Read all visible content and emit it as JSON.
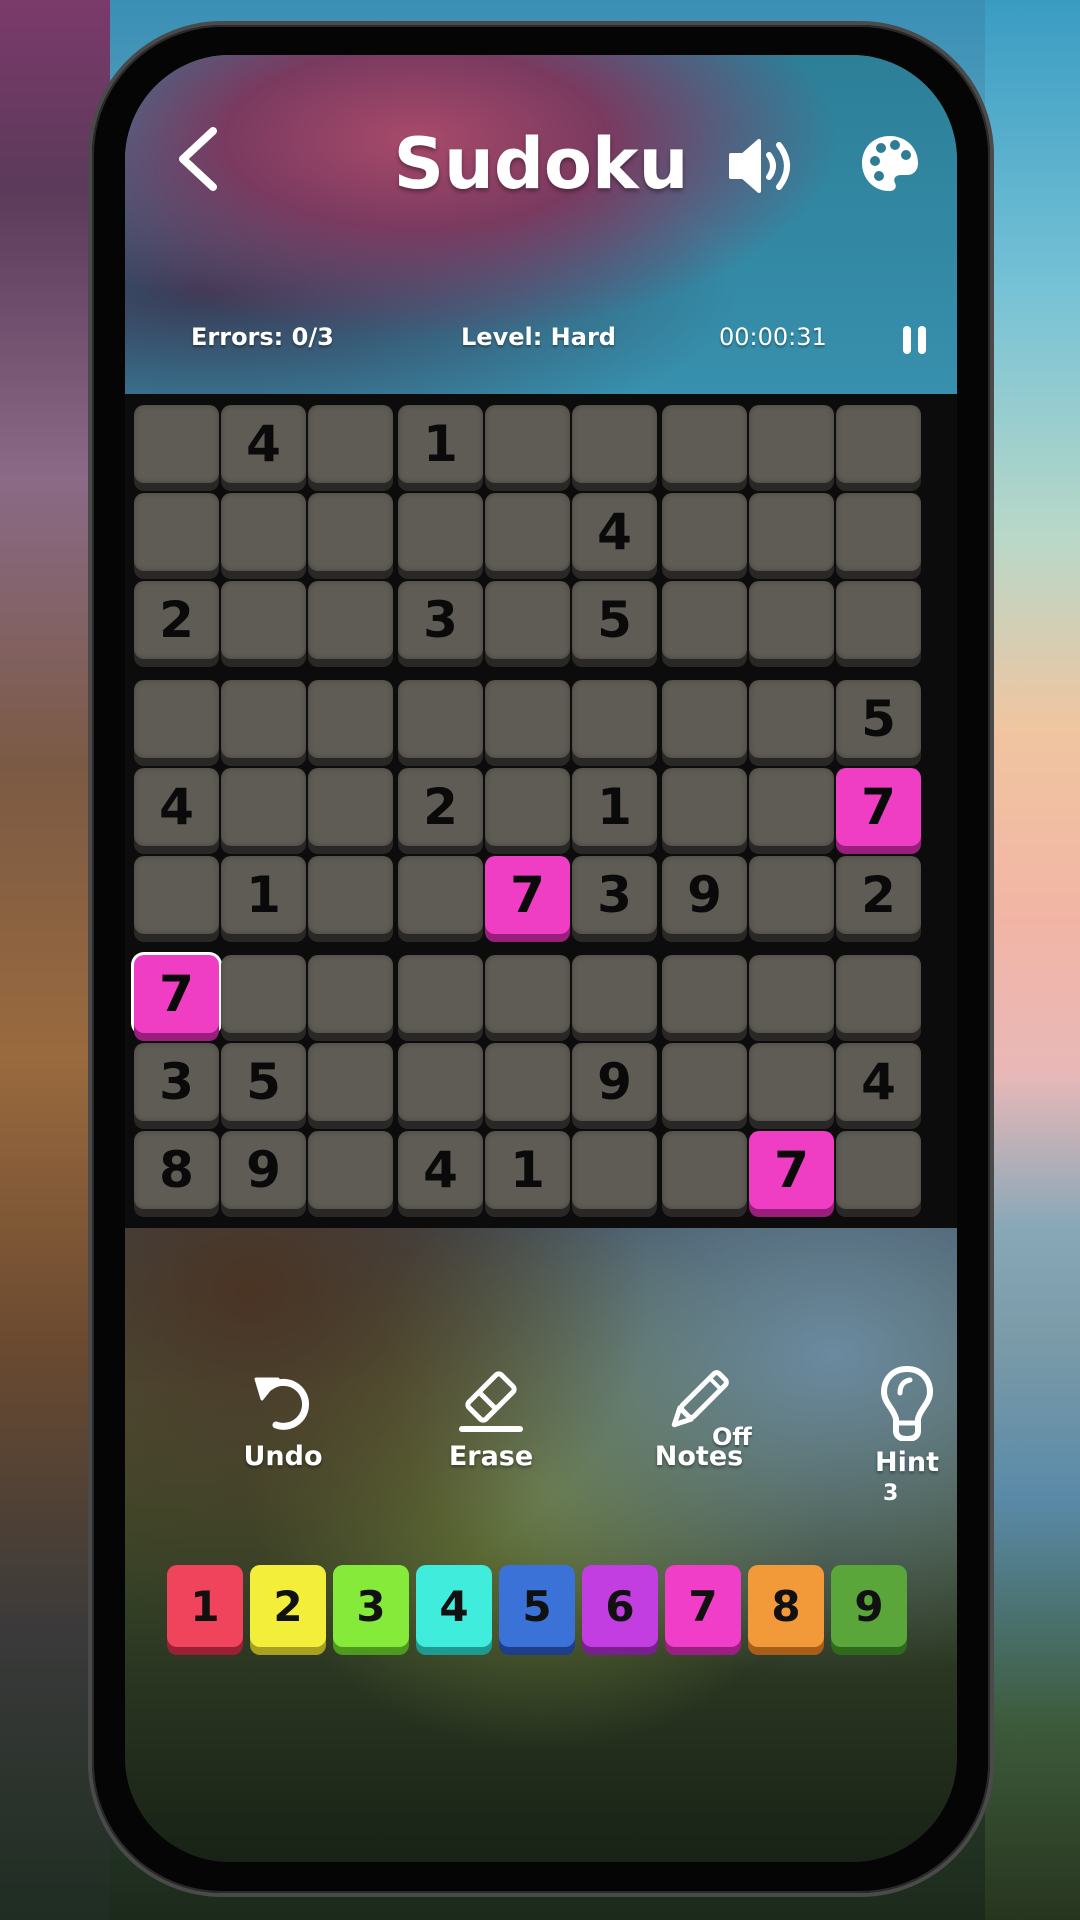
{
  "header": {
    "title": "Sudoku",
    "back_icon": "chevron-left-icon",
    "sound_icon": "speaker-volume-icon",
    "theme_icon": "palette-icon"
  },
  "status": {
    "errors": "Errors: 0/3",
    "level": "Level: Hard",
    "timer": "00:00:31",
    "pause_icon": "pause-icon"
  },
  "board": {
    "highlight_color": "#ef3ec4",
    "cell_color": "#5f5c55",
    "selected": {
      "row": 6,
      "col": 0
    },
    "highlighted_value": "7",
    "rows": [
      [
        "",
        "4",
        "",
        "1",
        "",
        "",
        "",
        "",
        ""
      ],
      [
        "",
        "",
        "",
        "",
        "",
        "4",
        "",
        "",
        ""
      ],
      [
        "2",
        "",
        "",
        "3",
        "",
        "5",
        "",
        "",
        ""
      ],
      [
        "",
        "",
        "",
        "",
        "",
        "",
        "",
        "",
        "5"
      ],
      [
        "4",
        "",
        "",
        "2",
        "",
        "1",
        "",
        "",
        "7"
      ],
      [
        "",
        "1",
        "",
        "",
        "7",
        "3",
        "9",
        "",
        "2"
      ],
      [
        "7",
        "",
        "",
        "",
        "",
        "",
        "",
        "",
        ""
      ],
      [
        "3",
        "5",
        "",
        "",
        "",
        "9",
        "",
        "",
        "4"
      ],
      [
        "8",
        "9",
        "",
        "4",
        "1",
        "",
        "",
        "7",
        ""
      ]
    ]
  },
  "tools": {
    "undo": {
      "label": "Undo",
      "icon": "undo-icon"
    },
    "erase": {
      "label": "Erase",
      "icon": "eraser-icon"
    },
    "notes": {
      "label": "Notes",
      "icon": "pencil-icon",
      "state": "Off"
    },
    "hint": {
      "label": "Hint",
      "icon": "lightbulb-icon",
      "count": "3"
    }
  },
  "numpad": [
    {
      "value": "1",
      "color": "#f0435c",
      "shadow": "#9a2035"
    },
    {
      "value": "2",
      "color": "#f2ee3a",
      "shadow": "#a8a020"
    },
    {
      "value": "3",
      "color": "#86ea3a",
      "shadow": "#4e9a1e"
    },
    {
      "value": "4",
      "color": "#40ecdc",
      "shadow": "#1f9a90"
    },
    {
      "value": "5",
      "color": "#3a72d8",
      "shadow": "#1d3f8a"
    },
    {
      "value": "6",
      "color": "#c23ee0",
      "shadow": "#78208e"
    },
    {
      "value": "7",
      "color": "#f03ec8",
      "shadow": "#9a1f80"
    },
    {
      "value": "8",
      "color": "#f29a3a",
      "shadow": "#a85e18"
    },
    {
      "value": "9",
      "color": "#5aa63a",
      "shadow": "#2f6a1c"
    }
  ]
}
